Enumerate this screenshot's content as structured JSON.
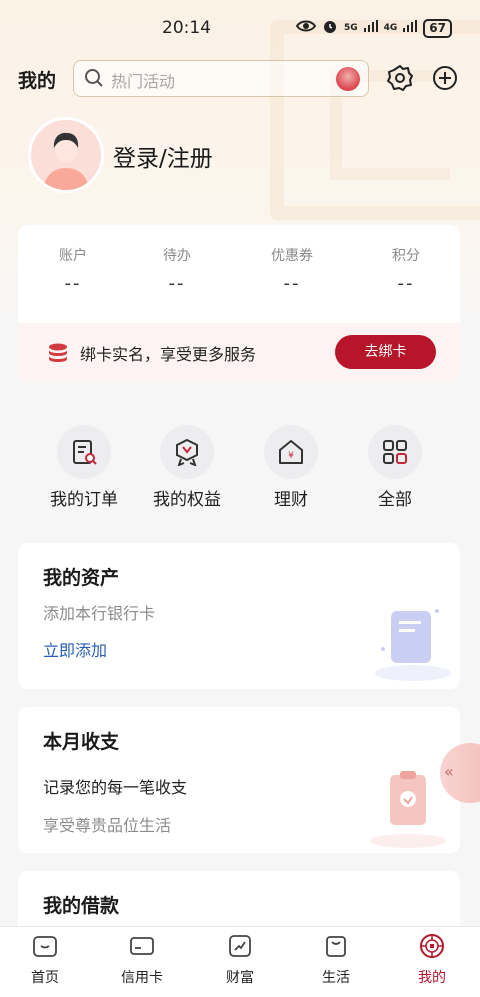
{
  "status_bar": {
    "time": "20:14",
    "network1": "5G",
    "network2": "4G",
    "battery": "67"
  },
  "header": {
    "title": "我的",
    "search_placeholder": "热门活动",
    "settings_icon": "gear-icon",
    "add_icon": "plus-circle-icon"
  },
  "profile": {
    "login_label": "登录/注册",
    "avatar_icon": "user-avatar"
  },
  "stats": [
    {
      "label": "账户",
      "value": "--"
    },
    {
      "label": "待办",
      "value": "--"
    },
    {
      "label": "优惠券",
      "value": "--"
    },
    {
      "label": "积分",
      "value": "--"
    }
  ],
  "bind_bar": {
    "text": "绑卡实名，享受更多服务",
    "button": "去绑卡"
  },
  "quick_entries": [
    {
      "label": "我的订单",
      "icon": "order-icon"
    },
    {
      "label": "我的权益",
      "icon": "badge-icon"
    },
    {
      "label": "理财",
      "icon": "finance-icon"
    },
    {
      "label": "全部",
      "icon": "grid-icon"
    }
  ],
  "assets_card": {
    "title": "我的资产",
    "subtitle": "添加本行银行卡",
    "link": "立即添加"
  },
  "budget_card": {
    "title": "本月收支",
    "desc": "记录您的每一笔收支",
    "subtitle": "享受尊贵品位生活"
  },
  "loan_card": {
    "title": "我的借款"
  },
  "tabbar": [
    {
      "label": "首页",
      "icon": "home-icon",
      "active": false
    },
    {
      "label": "信用卡",
      "icon": "credit-card-icon",
      "active": false
    },
    {
      "label": "财富",
      "icon": "wealth-icon",
      "active": false
    },
    {
      "label": "生活",
      "icon": "shopping-bag-icon",
      "active": false
    },
    {
      "label": "我的",
      "icon": "profile-emblem-icon",
      "active": true
    }
  ],
  "colors": {
    "accent": "#b7162a",
    "link": "#2a5fb8"
  }
}
